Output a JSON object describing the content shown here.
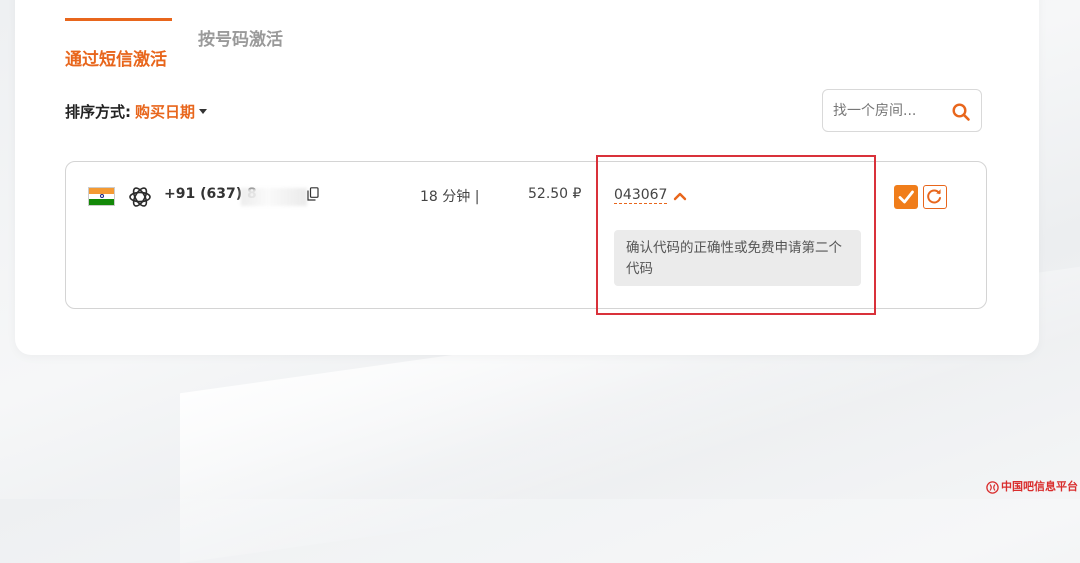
{
  "tabs": [
    {
      "label": "通过短信激活",
      "active": true
    },
    {
      "label": "按号码激活",
      "active": false
    }
  ],
  "sort": {
    "label": "排序方式:",
    "value": "购买日期"
  },
  "search": {
    "placeholder": "找一个房间..."
  },
  "order": {
    "country_flag": "india-flag-icon",
    "service_icon": "openai-icon",
    "phone_prefix": "+91 (637) 8",
    "elapsed_time": "18 分钟 |",
    "price": "52.50 ₽",
    "code": "043067",
    "tooltip": "确认代码的正确性或免费申请第二个代码"
  },
  "watermark": {
    "text": "中国吧信息平台"
  },
  "colors": {
    "accent": "#e8661c",
    "highlight_border": "#d9313a",
    "tooltip_bg": "#ebebeb",
    "confirm_bg": "#f07d1a"
  }
}
